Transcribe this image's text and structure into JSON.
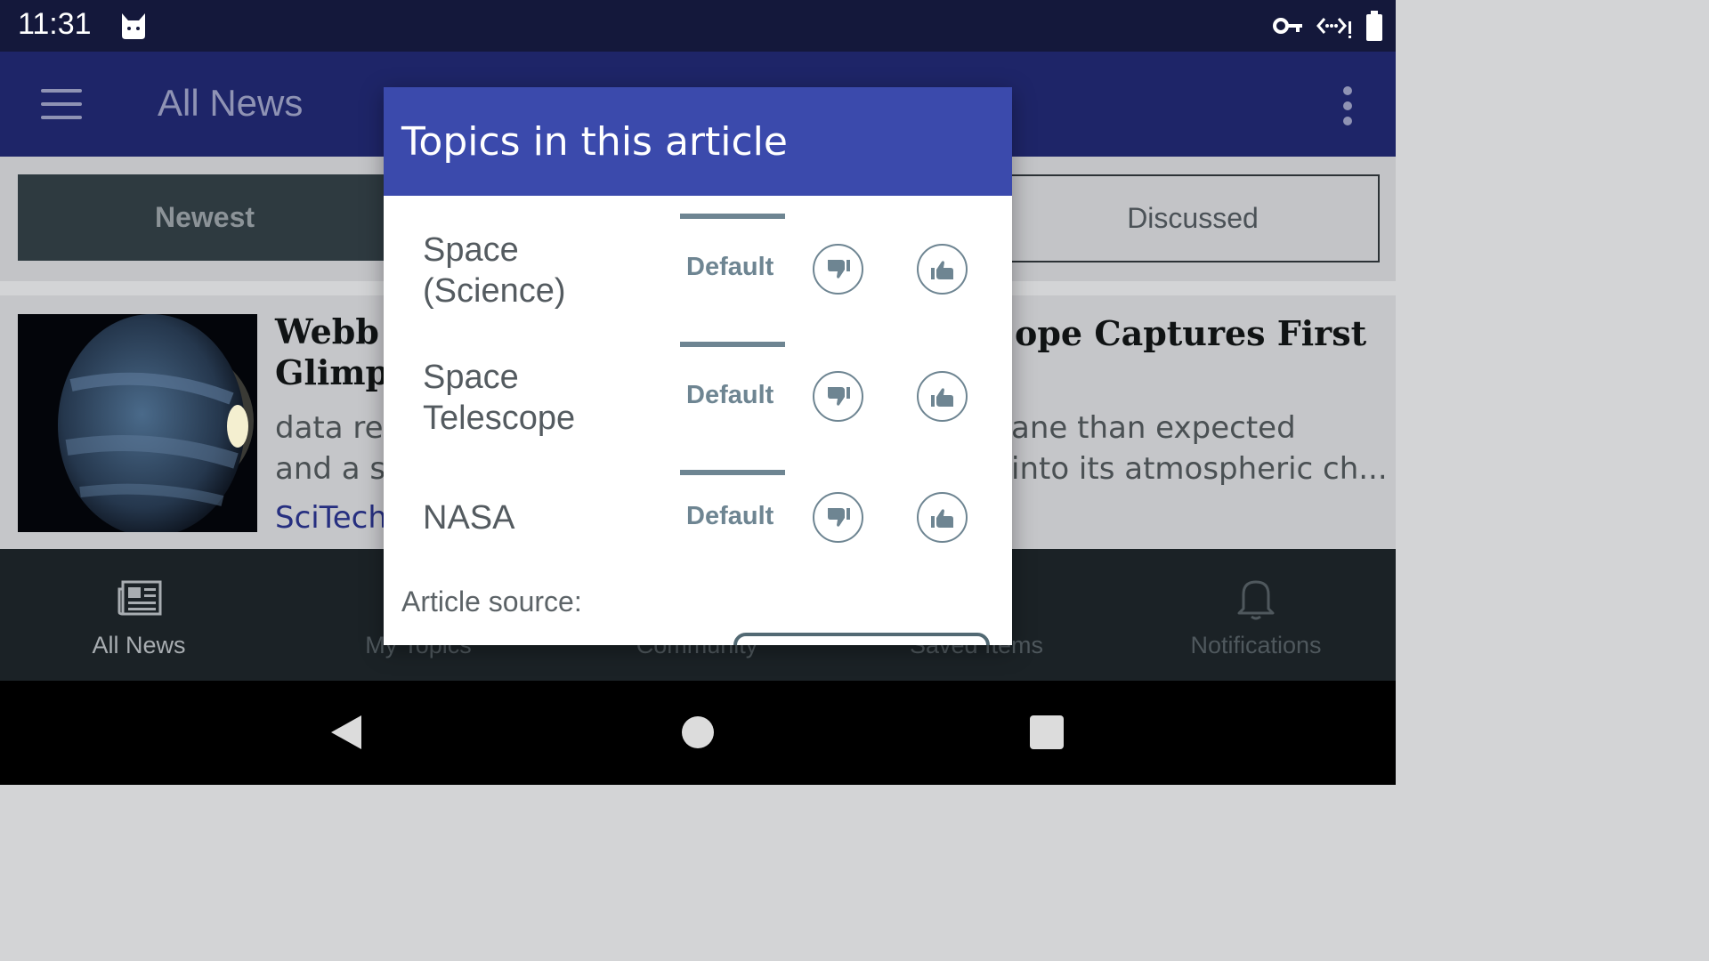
{
  "status_bar": {
    "time": "11:31"
  },
  "app_bar": {
    "title": "All News"
  },
  "sort_tabs": [
    {
      "label": "Newest",
      "selected": true
    },
    {
      "label": "Discussed",
      "selected": false
    }
  ],
  "article": {
    "title_left_line1": "Webb T",
    "title_left_line2": "Glimps",
    "title_right": "ope Captures First",
    "snippet_left_line1": "data rev",
    "snippet_left_line2": "and a su",
    "snippet_right_line1": "ane than expected",
    "snippet_right_line2": "into its atmospheric ch...",
    "source": "SciTech"
  },
  "bottom_nav": [
    {
      "label": "All News",
      "icon": "newspaper-icon",
      "active": true
    },
    {
      "label": "My Topics",
      "icon": "",
      "active": false
    },
    {
      "label": "Community",
      "icon": "",
      "active": false
    },
    {
      "label": "Saved Items",
      "icon": "",
      "active": false
    },
    {
      "label": "Notifications",
      "icon": "bell-icon",
      "active": false
    }
  ],
  "dialog": {
    "title": "Topics in this article",
    "topics": [
      {
        "name_line1": "Space",
        "name_line2": "(Science)",
        "status": "Default"
      },
      {
        "name_line1": "Space",
        "name_line2": "Telescope",
        "status": "Default"
      },
      {
        "name_line1": "NASA",
        "name_line2": "",
        "status": "Default"
      }
    ],
    "source_label": "Article source:"
  },
  "colors": {
    "status_bar": "#14183b",
    "app_bar": "#1e2568",
    "dialog_header": "#3b4aac",
    "topic_accent": "#6e8592",
    "source_link": "#262f80"
  }
}
